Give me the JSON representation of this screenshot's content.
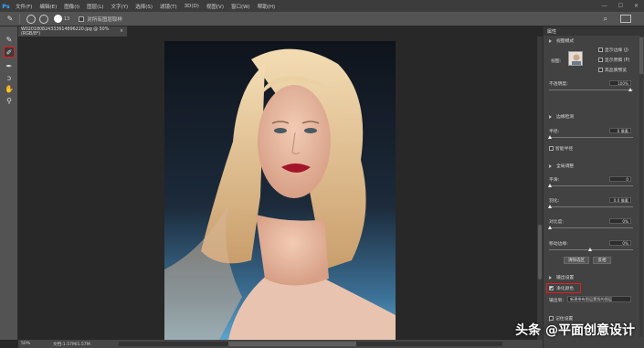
{
  "app": {
    "logo": "Ps"
  },
  "menu": [
    "文件(F)",
    "编辑(E)",
    "图像(I)",
    "图层(L)",
    "文字(Y)",
    "选择(S)",
    "滤镜(T)",
    "3D(D)",
    "视图(V)",
    "窗口(W)",
    "帮助(H)"
  ],
  "window_controls": [
    "—",
    "☐",
    "✕"
  ],
  "options": {
    "size_value": "13",
    "sample_all_layers_label": "对所有图层取样"
  },
  "document": {
    "tab_title": "W020180824333614896220.jpg @ 50%(RGB/8*)",
    "zoom": "50%",
    "doc_info": "文档:1.57M/1.57M"
  },
  "panel": {
    "tab": "属性",
    "view_section": {
      "title": "视图模式",
      "view_label": "视图:",
      "show_edge": "显示边缘 (J)",
      "show_original": "显示原稿 (P)",
      "hq_preview": "高品质预览",
      "opacity_label": "不透明度:",
      "opacity_value": "100%"
    },
    "edge_section": {
      "title": "边缘检测",
      "radius_label": "半径:",
      "radius_value": "0 像素",
      "smart_radius": "智能半径"
    },
    "global_section": {
      "title": "全局调整",
      "smooth_label": "平滑:",
      "smooth_value": "0",
      "feather_label": "羽化:",
      "feather_value": "0.0 像素",
      "contrast_label": "对比度:",
      "contrast_value": "0%",
      "shift_label": "移动边缘:",
      "shift_value": "0%",
      "clear_btn": "清除选区",
      "invert_btn": "反相"
    },
    "output_section": {
      "title": "输出设置",
      "decontam_label": "净化颜色",
      "output_to_label": "输出到:",
      "output_to_value": "新建带有图层蒙版的图层",
      "remember_label": "记住设置"
    }
  },
  "watermark": "头条 @平面创意设计",
  "colors": {
    "menubar": "#3c3c3c",
    "panel": "#424242",
    "highlight_box": "#e02020",
    "ps_blue": "#31a8ff"
  }
}
